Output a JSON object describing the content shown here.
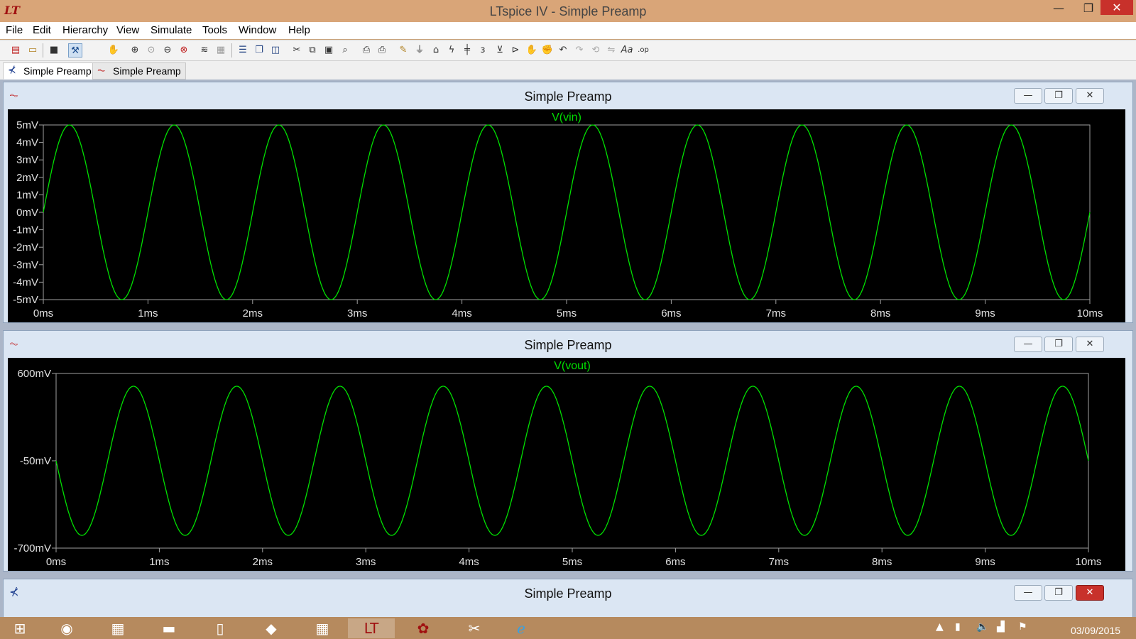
{
  "window": {
    "title": "LTspice IV - Simple Preamp",
    "min_glyph": "—",
    "max_glyph": "❐",
    "close_glyph": "✕"
  },
  "menu": [
    "File",
    "Edit",
    "Hierarchy",
    "View",
    "Simulate",
    "Tools",
    "Window",
    "Help"
  ],
  "toolbar": {
    "icons": [
      "new-schematic-icon",
      "open-icon",
      "save-icon",
      "control-panel-icon",
      "pan-icon",
      "zoom-in-icon",
      "zoom-back-icon",
      "zoom-out-icon",
      "zoom-fit-icon",
      "autorange-icon",
      "grid-icon",
      "tile-horizontal-icon",
      "cascade-icon",
      "tile-vertical-icon",
      "cut-icon",
      "copy-icon",
      "paste-icon",
      "find-icon",
      "print-preview-icon",
      "print-icon",
      "draw-wire-icon",
      "ground-icon",
      "label-net-icon",
      "resistor-icon",
      "capacitor-icon",
      "inductor-icon",
      "diode-icon",
      "component-icon",
      "move-icon",
      "drag-icon",
      "undo-icon",
      "redo-icon",
      "rotate-icon",
      "mirror-icon",
      "text-icon",
      "spice-directive-icon"
    ]
  },
  "tabs": [
    {
      "label": "Simple Preamp",
      "icon": "schematic-icon"
    },
    {
      "label": "Simple Preamp",
      "icon": "waveform-icon"
    }
  ],
  "panes": [
    {
      "title": "Simple Preamp",
      "icon": "waveform-icon",
      "close_active": false
    },
    {
      "title": "Simple Preamp",
      "icon": "waveform-icon",
      "close_active": false
    },
    {
      "title": "Simple Preamp",
      "icon": "schematic-icon",
      "close_active": true
    }
  ],
  "chart_data": [
    {
      "type": "line",
      "title": "",
      "series": [
        {
          "name": "V(vin)",
          "color": "#00e000",
          "amplitude": 5,
          "offset": 0,
          "frequency_khz": 1,
          "phase_deg": 0
        }
      ],
      "xlabel": "",
      "ylabel": "",
      "x_ticks": [
        "0ms",
        "1ms",
        "2ms",
        "3ms",
        "4ms",
        "5ms",
        "6ms",
        "7ms",
        "8ms",
        "9ms",
        "10ms"
      ],
      "xlim": [
        0,
        10
      ],
      "y_ticks": [
        "5mV",
        "4mV",
        "3mV",
        "2mV",
        "1mV",
        "0mV",
        "-1mV",
        "-2mV",
        "-3mV",
        "-4mV",
        "-5mV"
      ],
      "y_tick_values": [
        5,
        4,
        3,
        2,
        1,
        0,
        -1,
        -2,
        -3,
        -4,
        -5
      ],
      "ylim": [
        -5,
        5
      ],
      "x_unit": "ms",
      "y_unit": "mV",
      "background": "#000000",
      "grid": false
    },
    {
      "type": "line",
      "title": "",
      "series": [
        {
          "name": "V(vout)",
          "color": "#00e000",
          "amplitude": 555,
          "offset": -50,
          "frequency_khz": 1,
          "phase_deg": 180
        }
      ],
      "xlabel": "",
      "ylabel": "",
      "x_ticks": [
        "0ms",
        "1ms",
        "2ms",
        "3ms",
        "4ms",
        "5ms",
        "6ms",
        "7ms",
        "8ms",
        "9ms",
        "10ms"
      ],
      "xlim": [
        0,
        10
      ],
      "y_ticks": [
        "600mV",
        "-50mV",
        "-700mV"
      ],
      "y_tick_values": [
        600,
        -50,
        -700
      ],
      "ylim": [
        -700,
        600
      ],
      "x_unit": "ms",
      "y_unit": "mV",
      "background": "#000000",
      "grid": false
    }
  ],
  "taskbar": {
    "items": [
      "windows-start-icon",
      "network-icon",
      "files-icon",
      "explorer-icon",
      "notepad-icon",
      "app-icon",
      "calculator-icon",
      "ltspice-icon",
      "paint-icon",
      "snipping-tool-icon",
      "internet-explorer-icon"
    ],
    "date": "03/09/2015"
  }
}
